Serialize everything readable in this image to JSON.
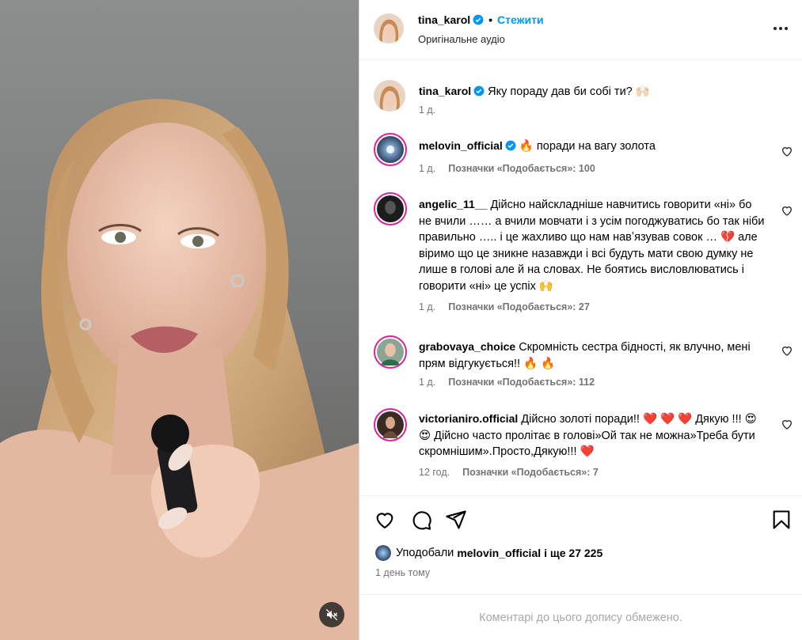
{
  "post": {
    "author": "tina_karol",
    "follow_label": "Стежити",
    "dot": "•",
    "audio_label": "Оригінальне аудіо",
    "caption_username": "tina_karol",
    "caption_text": "Яку пораду дав би собі ти? 🙌🏻",
    "caption_time": "1 д."
  },
  "comments": [
    {
      "username": "melovin_official",
      "verified": true,
      "text": "🔥  поради на вагу золота",
      "time": "1 д.",
      "likes": "Позначки «Подобається»: 100"
    },
    {
      "username": "angelic_11__",
      "verified": false,
      "text": "Дійсно найскладніше навчитись говорити «ні» бо не вчили …… а вчили мовчати і з усім погоджуватись бо так ніби правильно ….. і це жахливо що нам навʼязував совок … 💔 але віримо що це зникне назавжди і всі будуть мати свою думку не лише в голові але й на словах. Не боятись висловлюватись і говорити «ні» це успіх 🙌",
      "time": "1 д.",
      "likes": "Позначки «Подобається»: 27"
    },
    {
      "username": "grabovaya_choice",
      "verified": false,
      "text": "Скромність сестра бідності, як влучно, мені прям відгукується!! 🔥 🔥",
      "time": "1 д.",
      "likes": "Позначки «Подобається»: 112"
    },
    {
      "username": "victorianiro.official",
      "verified": false,
      "text": "Дійсно золоті поради!! ❤️ ❤️ ❤️ Дякую !!! 😍 😍 Дійсно часто пролітає в голові»Ой так не можна»Треба бути скромнішим».Просто,Дякую!!! ❤️",
      "time": "12 год.",
      "likes": "Позначки «Подобається»: 7"
    }
  ],
  "likes_summary": {
    "prefix": "Уподобали",
    "user": "melovin_official",
    "suffix": "і ще 27 225"
  },
  "post_time": "1 день тому",
  "footer_note": "Коментарі до цього допису обмежено.",
  "colors": {
    "accent": "#0095f6",
    "verified": "#0095f6",
    "muted_text": "#737373",
    "story_ring": "#d6249f"
  },
  "icons": [
    "verified-badge-icon",
    "more-icon",
    "heart-icon",
    "comment-icon",
    "share-icon",
    "bookmark-icon",
    "mute-icon"
  ]
}
